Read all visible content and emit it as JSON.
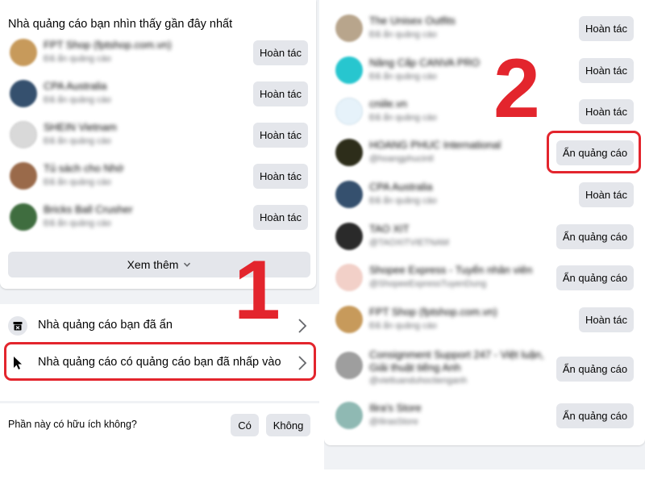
{
  "left_panel": {
    "card_title": "Nhà quảng cáo bạn nhìn thấy gần đây nhất",
    "advertisers": [
      {
        "name": "FPT Shop (fptshop.com.vn)",
        "sub": "Đã ẩn quảng cáo",
        "action": "Hoàn tác",
        "avatar_color": "#c79a5b"
      },
      {
        "name": "CPA Australia",
        "sub": "Đã ẩn quảng cáo",
        "action": "Hoàn tác",
        "avatar_color": "#35506e"
      },
      {
        "name": "SHEIN Vietnam",
        "sub": "Đã ẩn quảng cáo",
        "action": "Hoàn tác",
        "avatar_color": "#d9d9d9"
      },
      {
        "name": "Tủ sách cho Nhớ",
        "sub": "Đã ẩn quảng cáo",
        "action": "Hoàn tác",
        "avatar_color": "#9a6a4a"
      },
      {
        "name": "Bricks Ball Crusher",
        "sub": "Đã ẩn quảng cáo",
        "action": "Hoàn tác",
        "avatar_color": "#3f6d3f"
      }
    ],
    "see_more_label": "Xem thêm",
    "nav_items": [
      {
        "label": "Nhà quảng cáo bạn đã ẩn"
      },
      {
        "label": "Nhà quảng cáo có quảng cáo bạn đã nhấp vào"
      }
    ],
    "feedback_question": "Phần này có hữu ích không?",
    "yes_label": "Có",
    "no_label": "Không",
    "step_number": "1"
  },
  "right_panel": {
    "advertisers": [
      {
        "name": "The Unisex Outfits",
        "sub": "Đã ẩn quảng cáo",
        "action": "Hoàn tác",
        "avatar_color": "#b8a58c"
      },
      {
        "name": "Nâng Cấp CANVA PRO",
        "sub": "Đã ẩn quảng cáo",
        "action": "Hoàn tác",
        "avatar_color": "#27c6cf"
      },
      {
        "name": "cniile.vn",
        "sub": "Đã ẩn quảng cáo",
        "action": "Hoàn tác",
        "avatar_color": "#e6f2fa"
      },
      {
        "name": "HOANG PHUC International",
        "sub": "@hoangphucintl",
        "action": "Ẩn quảng cáo",
        "avatar_color": "#2d2d1a"
      },
      {
        "name": "CPA Australia",
        "sub": "Đã ẩn quảng cáo",
        "action": "Hoàn tác",
        "avatar_color": "#35506e"
      },
      {
        "name": "TAO XIT",
        "sub": "@TAOXITVIETNAM",
        "action": "Ẩn quảng cáo",
        "avatar_color": "#2a2a2a"
      },
      {
        "name": "Shopee Express - Tuyển nhân viên",
        "sub": "@ShopeeExpressTuyenDung",
        "action": "Ẩn quảng cáo",
        "avatar_color": "#f2d0c8"
      },
      {
        "name": "FPT Shop (fptshop.com.vn)",
        "sub": "Đã ẩn quảng cáo",
        "action": "Hoàn tác",
        "avatar_color": "#c79a5b"
      },
      {
        "name": "Consignment Support 247 - Việt luận, Giải thuật tiếng Anh",
        "sub": "@vietluanduhoctienganh",
        "action": "Ẩn quảng cáo",
        "avatar_color": "#9e9e9e"
      },
      {
        "name": "Ilira's Store",
        "sub": "@IlirasStore",
        "action": "Ẩn quảng cáo",
        "avatar_color": "#8fb9b3"
      }
    ],
    "step_number": "2"
  },
  "colors": {
    "highlight_red": "#e3252d",
    "button_grey": "#e4e6eb",
    "background_grey": "#f0f2f5"
  }
}
